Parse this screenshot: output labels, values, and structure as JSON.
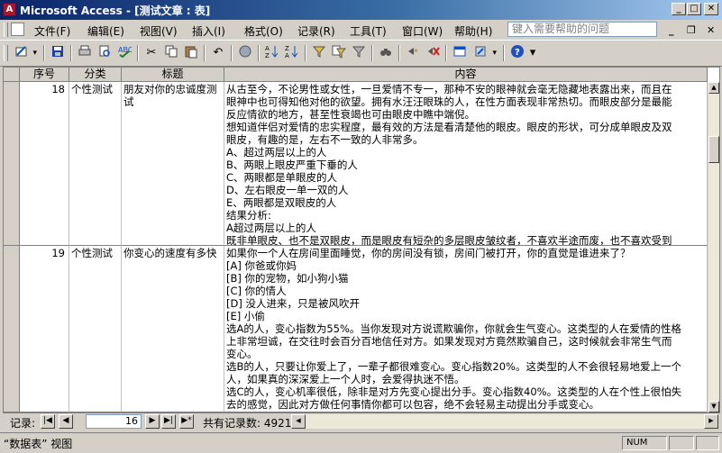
{
  "window": {
    "title": "Microsoft Access - [测试文章 : 表]"
  },
  "menubar": {
    "items": [
      "文件(F)",
      "编辑(E)",
      "视图(V)",
      "插入(I)",
      "格式(O)",
      "记录(R)",
      "工具(T)",
      "窗口(W)",
      "帮助(H)"
    ],
    "help_placeholder": "键入需要帮助的问题"
  },
  "toolbar": {
    "icons": [
      "design-view-icon",
      "save-icon",
      "print-icon",
      "print-preview-icon",
      "spelling-icon",
      "cut-icon",
      "copy-icon",
      "paste-icon",
      "undo-icon",
      "insert-hyperlink-icon",
      "sort-ascending-icon",
      "sort-descending-icon",
      "filter-by-selection-icon",
      "filter-by-form-icon",
      "apply-filter-icon",
      "find-icon",
      "new-record-icon",
      "delete-record-icon",
      "database-window-icon",
      "new-object-icon",
      "help-icon"
    ]
  },
  "table": {
    "columns": [
      "序号",
      "分类",
      "标题",
      "内容"
    ],
    "rows": [
      {
        "id": "18",
        "category": "个性测试",
        "title": "朋友对你的忠诚度测试",
        "content_lines": [
          "从古至今，不论男性或女性，一旦爱情不专一，那种不安的眼神就会毫无隐藏地表露出来，而且在",
          "眼神中也可得知他对他的欲望。拥有水汪汪眼珠的人，在性方面表现非常热切。而眼皮部分是最能",
          "反应情欲的地方，甚至性衰竭也可由眼皮中瞧中端倪。",
          "想知道伴侣对爱情的忠实程度，最有效的方法是看清楚他的眼皮。眼皮的形状，可分成单眼皮及双",
          "眼皮，有趣的是，左右不一致的人非常多。",
          "A、超过两层以上的人",
          "B、两眼上眼皮严重下垂的人",
          "C、两眼都是单眼皮的人",
          "D、左右眼皮一单一双的人",
          "E、两眼都是双眼皮的人",
          "结果分析:",
          "A超过两层以上的人",
          "既非单眼皮、也不是双眼皮，而是眼皮有短杂的多层眼皮皱纹者，不喜欢半途而废，也不喜欢受到"
        ]
      },
      {
        "id": "19",
        "category": "个性测试",
        "title": "你变心的速度有多快",
        "content_lines": [
          "如果你一个人在房间里面睡觉，你的房间没有锁，房间门被打开，你的直觉是谁进来了？",
          "[A] 你爸或你妈",
          "[B] 你的宠物，如小狗小猫",
          "[C] 你的情人",
          "[D] 没人进来，只是被风吹开",
          "[E] 小偷",
          "选A的人，变心指数为55%。当你发现对方说谎欺骗你，你就会生气变心。这类型的人在爱情的性格",
          "上非常坦诚，在交往时会百分百地信任对方。如果发现对方竟然欺骗自己，这时候就会非常生气而",
          "变心。",
          "选B的人，只要让你爱上了，一辈子都很难变心。变心指数20%。这类型的人不会很轻易地爱上一个",
          "人，如果真的深深爱上一个人时，会爱得执迷不悟。",
          "选C的人，变心机率很低，除非是对方先变心提出分手。变心指数40%。这类型的人在个性上很怕失",
          "去的感觉，因此对方做任何事情你都可以包容，绝不会轻易主动提出分手或变心。"
        ]
      }
    ]
  },
  "navigation": {
    "label": "记录:",
    "current_record": "16",
    "total_label": "共有记录数: 4921"
  },
  "status": {
    "view_text": "“数据表” 视图",
    "num_indicator": "NUM"
  }
}
